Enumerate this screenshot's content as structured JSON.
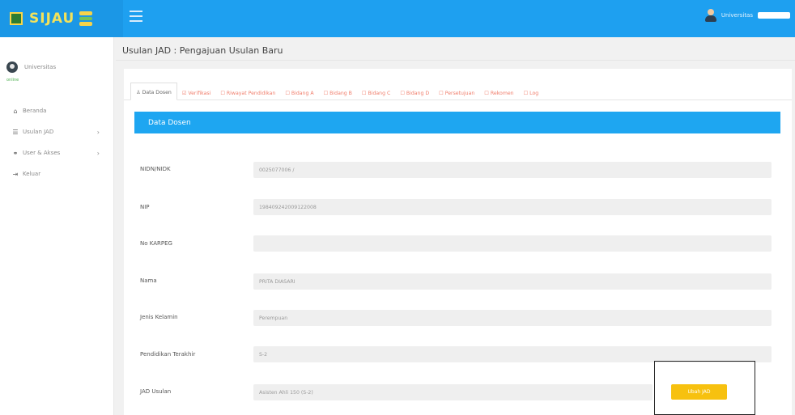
{
  "app": {
    "brand": "SIJAU",
    "user_name": "Universitas"
  },
  "sidebar": {
    "profile_name": "Universitas",
    "profile_status": "online",
    "items": [
      {
        "label": "Beranda",
        "icon": "home-icon",
        "has_children": false
      },
      {
        "label": "Usulan JAD",
        "icon": "list-icon",
        "has_children": true
      },
      {
        "label": "User & Akses",
        "icon": "users-icon",
        "has_children": true
      },
      {
        "label": "Keluar",
        "icon": "logout-icon",
        "has_children": false
      }
    ]
  },
  "page": {
    "title": "Usulan JAD : Pengajuan Usulan Baru"
  },
  "tabs": [
    {
      "label": "Data Dosen",
      "icon": "user-icon",
      "active": true
    },
    {
      "label": "Verifikasi",
      "icon": "check-icon",
      "active": false
    },
    {
      "label": "Riwayat Pendidikan",
      "icon": "file-icon",
      "active": false
    },
    {
      "label": "Bidang A",
      "icon": "file-icon",
      "active": false
    },
    {
      "label": "Bidang B",
      "icon": "file-icon",
      "active": false
    },
    {
      "label": "Bidang C",
      "icon": "file-icon",
      "active": false
    },
    {
      "label": "Bidang D",
      "icon": "file-icon",
      "active": false
    },
    {
      "label": "Persetujuan",
      "icon": "file-icon",
      "active": false
    },
    {
      "label": "Rekomen",
      "icon": "file-icon",
      "active": false
    },
    {
      "label": "Log",
      "icon": "file-icon",
      "active": false
    }
  ],
  "section": {
    "header": "Data Dosen"
  },
  "form": {
    "fields": [
      {
        "label": "NIDN/NIDK",
        "value": "0025077006 /"
      },
      {
        "label": "NIP",
        "value": "198409242009122008"
      },
      {
        "label": "No KARPEG",
        "value": ""
      },
      {
        "label": "Nama",
        "value": "PRITA DIASARI"
      },
      {
        "label": "Jenis Kelamin",
        "value": "Perempuan"
      },
      {
        "label": "Pendidikan Terakhir",
        "value": "S-2"
      },
      {
        "label": "JAD Usulan",
        "value": "Asisten Ahli 150 (S-2)"
      }
    ],
    "change_button": "Ubah JAD"
  },
  "colors": {
    "topbar": "#1ea0f0",
    "section_header": "#1ea6f1",
    "tab_text": "#f07c6a",
    "button": "#f7c10f"
  }
}
